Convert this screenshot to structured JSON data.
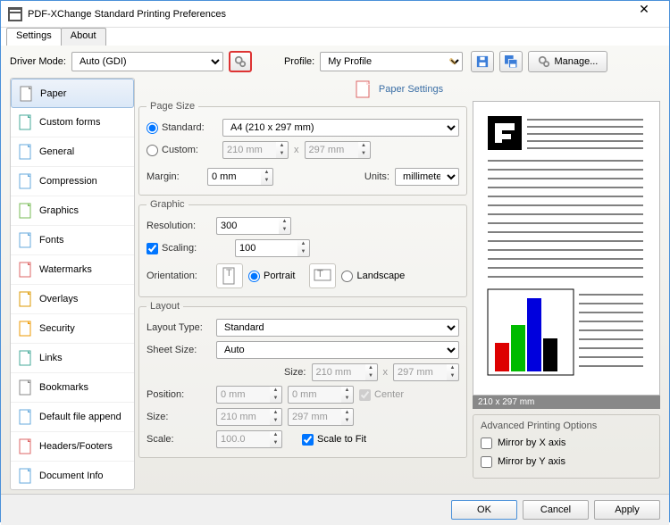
{
  "window": {
    "title": "PDF-XChange Standard Printing Preferences"
  },
  "tabs": {
    "settings": "Settings",
    "about": "About"
  },
  "toprow": {
    "driver_mode_label": "Driver Mode:",
    "driver_mode_value": "Auto (GDI)",
    "profile_label": "Profile:",
    "profile_value": "My Profile",
    "manage_label": "Manage..."
  },
  "sidebar": [
    "Paper",
    "Custom forms",
    "General",
    "Compression",
    "Graphics",
    "Fonts",
    "Watermarks",
    "Overlays",
    "Security",
    "Links",
    "Bookmarks",
    "Default file append",
    "Headers/Footers",
    "Document Info"
  ],
  "header": {
    "title": "Paper Settings"
  },
  "page_size": {
    "legend": "Page Size",
    "standard_label": "Standard:",
    "standard_value": "A4 (210 x 297 mm)",
    "custom_label": "Custom:",
    "custom_w": "210 mm",
    "custom_h": "297 mm",
    "x": "x",
    "margin_label": "Margin:",
    "margin_value": "0 mm",
    "units_label": "Units:",
    "units_value": "millimeter"
  },
  "graphic": {
    "legend": "Graphic",
    "resolution_label": "Resolution:",
    "resolution_value": "300",
    "scaling_label": "Scaling:",
    "scaling_value": "100",
    "orientation_label": "Orientation:",
    "portrait": "Portrait",
    "landscape": "Landscape"
  },
  "layout": {
    "legend": "Layout",
    "type_label": "Layout Type:",
    "type_value": "Standard",
    "sheet_label": "Sheet Size:",
    "sheet_value": "Auto",
    "size_hdr": "Size:",
    "size_w": "210 mm",
    "size_h": "297 mm",
    "pos_label": "Position:",
    "pos_x": "0 mm",
    "pos_y": "0 mm",
    "center": "Center",
    "size_label": "Size:",
    "s_w": "210 mm",
    "s_h": "297 mm",
    "scale_label": "Scale:",
    "scale_value": "100.0",
    "fit": "Scale to Fit"
  },
  "preview": {
    "caption": "210 x 297 mm"
  },
  "advanced": {
    "legend": "Advanced Printing Options",
    "mirror_x": "Mirror by X axis",
    "mirror_y": "Mirror by Y axis"
  },
  "footer": {
    "ok": "OK",
    "cancel": "Cancel",
    "apply": "Apply"
  },
  "sidebar_colors": [
    "#888",
    "#4a9",
    "#6ad",
    "#6ad",
    "#7b5",
    "#6ad",
    "#d66",
    "#d90",
    "#e90",
    "#4a9",
    "#888",
    "#6ad",
    "#d66",
    "#6ad"
  ]
}
